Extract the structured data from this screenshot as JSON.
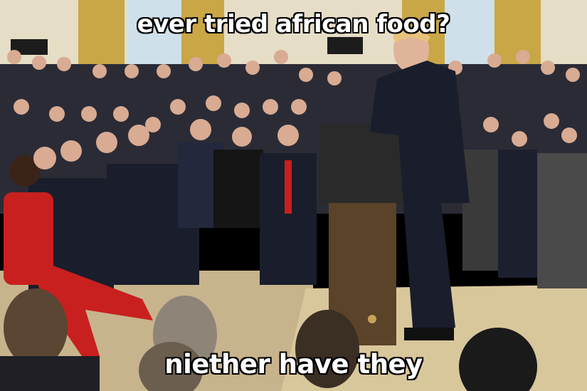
{
  "meme": {
    "top_text": "ever tried african food?",
    "bottom_text": "niether have they"
  },
  "colors": {
    "wall": "#e6ddc6",
    "curtain": "#c9a646",
    "window": "#cfe0ea",
    "carpet": "#c7b48d",
    "stage": "#d9c79c",
    "podium": "#5a4328",
    "suit_dark": "#1a1d2b",
    "red_outfit": "#c8201f",
    "skin": "#e0b49a"
  }
}
